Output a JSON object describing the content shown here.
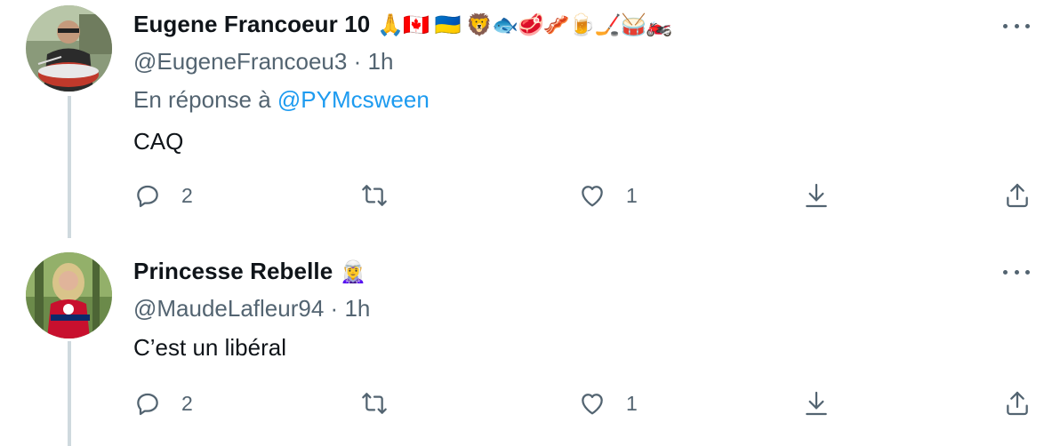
{
  "tweets": [
    {
      "display_name": "Eugene Francoeur 10",
      "name_emojis": "🙏🇨🇦 🇺🇦 🦁🐟🥩🥓🍺🏒🥁🏍️",
      "handle": "@EugeneFrancoeu3",
      "separator": "·",
      "time": "1h",
      "reply_prefix": "En réponse à",
      "reply_mention": "@PYMcsween",
      "text": "CAQ",
      "replies": "2",
      "retweets": "",
      "likes": "1"
    },
    {
      "display_name": "Princesse Rebelle",
      "name_emojis": "🧝‍♀️",
      "handle": "@MaudeLafleur94",
      "separator": "·",
      "time": "1h",
      "text": "C’est un libéral",
      "replies": "2",
      "retweets": "",
      "likes": "1"
    }
  ],
  "colors": {
    "text": "#0f1419",
    "secondary": "#536471",
    "link": "#1d9bf0",
    "thread_line": "#cfd9de"
  }
}
